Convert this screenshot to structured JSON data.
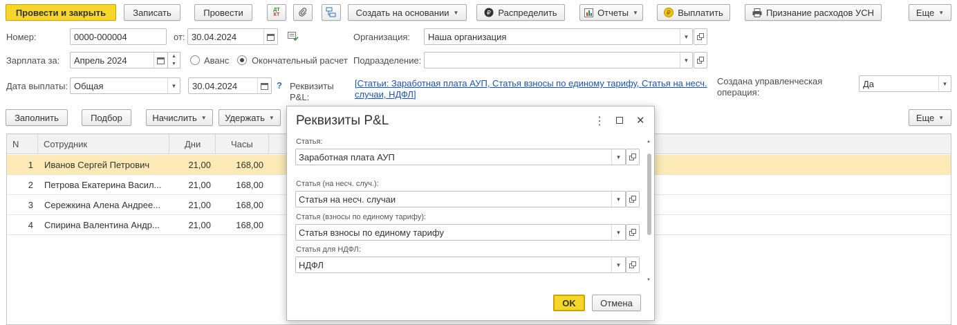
{
  "toolbar": {
    "post_close": "Провести и закрыть",
    "save": "Записать",
    "post": "Провести",
    "create_based": "Создать на основании",
    "distribute": "Распределить",
    "reports": "Отчеты",
    "pay": "Выплатить",
    "usn_expenses": "Признание расходов УСН",
    "more": "Еще"
  },
  "header": {
    "number_label": "Номер:",
    "number_value": "0000-000004",
    "date_label": "от:",
    "date_value": "30.04.2024",
    "org_label": "Организация:",
    "org_value": "Наша организация",
    "salary_for_label": "Зарплата за:",
    "salary_for_value": "Апрель 2024",
    "advance_label": "Аванс",
    "final_label": "Окончательный расчет",
    "dept_label": "Подразделение:",
    "dept_value": "",
    "paydate_label": "Дата выплаты:",
    "paydate_type": "Общая",
    "paydate_value": "30.04.2024",
    "help_mark": "?",
    "pl_label": "Реквизиты P&L:",
    "pl_link": "[Статьи: Заработная плата АУП, Статья взносы по единому тарифу, Статья на несч. случаи, НДФЛ]",
    "mgmt_label": "Создана управленческая операция:",
    "mgmt_value": "Да"
  },
  "table_toolbar": {
    "fill": "Заполнить",
    "select": "Подбор",
    "accrue": "Начислить",
    "withhold": "Удержать",
    "more": "Еще"
  },
  "table": {
    "columns": [
      "N",
      "Сотрудник",
      "Дни",
      "Часы"
    ],
    "rows": [
      {
        "n": "1",
        "employee": "Иванов Сергей Петрович",
        "days": "21,00",
        "hours": "168,00"
      },
      {
        "n": "2",
        "employee": "Петрова Екатерина Васил...",
        "days": "21,00",
        "hours": "168,00"
      },
      {
        "n": "3",
        "employee": "Сережкина Алена Андрее...",
        "days": "21,00",
        "hours": "168,00"
      },
      {
        "n": "4",
        "employee": "Спирина Валентина Андр...",
        "days": "21,00",
        "hours": "168,00"
      }
    ]
  },
  "dialog": {
    "title": "Реквизиты P&L",
    "article_label": "Статья:",
    "article_value": "Заработная плата АУП",
    "accident_label": "Статья (на несч. случ.):",
    "accident_value": "Статья на несч. случаи",
    "contrib_label": "Статья (взносы по единому тарифу):",
    "contrib_value": "Статья взносы по единому тарифу",
    "ndfl_label": "Статья для НДФЛ:",
    "ndfl_value": "НДФЛ",
    "ok": "OK",
    "cancel": "Отмена",
    "menu_glyph": "⋮",
    "close_glyph": "✕"
  },
  "colors": {
    "primary": "#f7d62c",
    "selected_row": "#fbeab5",
    "link": "#1a55b0"
  }
}
